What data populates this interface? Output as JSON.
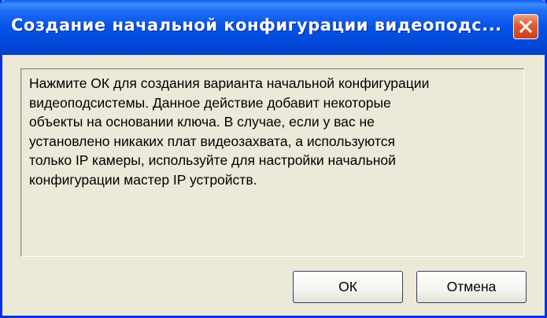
{
  "window": {
    "title": "Создание начальной конфигурации видеоподс...",
    "close_icon": "close-icon"
  },
  "message": {
    "lines": [
      "Нажмите ОК для создания варианта начальной конфигурации",
      "видеоподсистемы. Данное действие добавит некоторые",
      "объекты на основании ключа. В случае, если у вас не",
      "установлено никаких плат видеозахвата, а используются",
      "только IP камеры, используйте для настройки начальной",
      "конфигурации мастер IP устройств."
    ]
  },
  "buttons": {
    "ok_label": "ОК",
    "cancel_label": "Отмена"
  },
  "colors": {
    "titlebar": "#0453e6",
    "close_button": "#e2592f",
    "dialog_background": "#ece9d8"
  }
}
